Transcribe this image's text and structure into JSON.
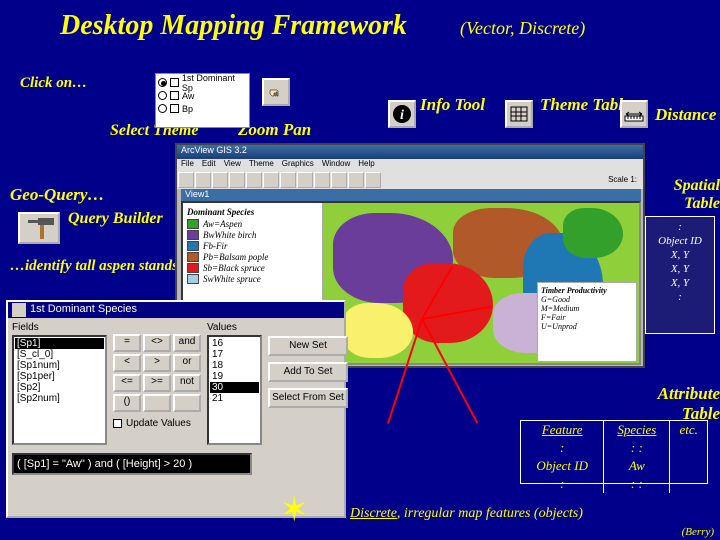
{
  "title": "Desktop Mapping Framework",
  "subtitle": "(Vector, Discrete)",
  "labels": {
    "click_on": "Click on…",
    "select_theme": "Select Theme",
    "zoom_pan": "Zoom  Pan",
    "info_tool": "Info Tool",
    "theme_table": "Theme Table",
    "distance": "Distance",
    "geo_query": "Geo-Query…",
    "query_builder": "Query Builder",
    "identify": "…identify tall aspen stands",
    "spatial_table": "Spatial Table",
    "attribute_table": "Attribute Table"
  },
  "theme_panel": {
    "rows": [
      "1st Dominant Sp",
      "Aw",
      "Bp"
    ]
  },
  "arcview": {
    "title": "ArcView GIS 3.2",
    "menu": [
      "File",
      "Edit",
      "View",
      "Theme",
      "Graphics",
      "Window",
      "Help"
    ],
    "scale": "Scale 1:",
    "view_title": "View1",
    "legend": {
      "title": "Dominant Species",
      "items": [
        {
          "color": "#34a02c",
          "label": "Aw=Aspen"
        },
        {
          "color": "#6a3d9a",
          "label": "BwWhite birch"
        },
        {
          "color": "#1f78b4",
          "label": "Fb-Fir"
        },
        {
          "color": "#b15928",
          "label": "Pb=Balsam pople"
        },
        {
          "color": "#e31a1c",
          "label": "Sb=Black spruce"
        },
        {
          "color": "#a6cee3",
          "label": "SwWhite spruce"
        }
      ]
    },
    "tp_panel": {
      "title": "Timber Productivity",
      "rows": [
        "G=Good",
        "M=Medium",
        "F=Fair",
        "U=Unprod"
      ]
    }
  },
  "query_win": {
    "title": "1st Dominant Species",
    "fields_label": "Fields",
    "values_label": "Values",
    "fields": [
      "[Sp1]",
      "[S_cl_0]",
      "[Sp1num]",
      "[Sp1per]",
      "[Sp2]",
      "[Sp2num]"
    ],
    "selected_field": "[Sp1]",
    "ops": [
      "=",
      "<>",
      "and",
      "<",
      ">",
      "or",
      "<=",
      ">=",
      "not",
      "()",
      "",
      ""
    ],
    "values": [
      "16",
      "17",
      "18",
      "19",
      "30",
      "21"
    ],
    "selected_value": "30",
    "update_values": "Update Values",
    "expr": "( [Sp1] = \"Aw\" ) and ( [Height] > 20 )",
    "buttons": [
      "New Set",
      "Add To Set",
      "Select From Set"
    ]
  },
  "spatial_rows": [
    ":",
    "Object ID",
    "X, Y",
    "X, Y",
    "X, Y",
    ":"
  ],
  "attribute": {
    "headers": [
      "Feature",
      "Species",
      "etc."
    ],
    "rows": [
      [
        ":",
        ": :",
        ""
      ],
      [
        "Object ID",
        "Aw",
        ""
      ],
      [
        ":",
        ": :",
        ""
      ]
    ]
  },
  "footnote": {
    "u": "Discrete",
    "rest": ", irregular map features (objects)"
  },
  "credit": "(Berry)"
}
